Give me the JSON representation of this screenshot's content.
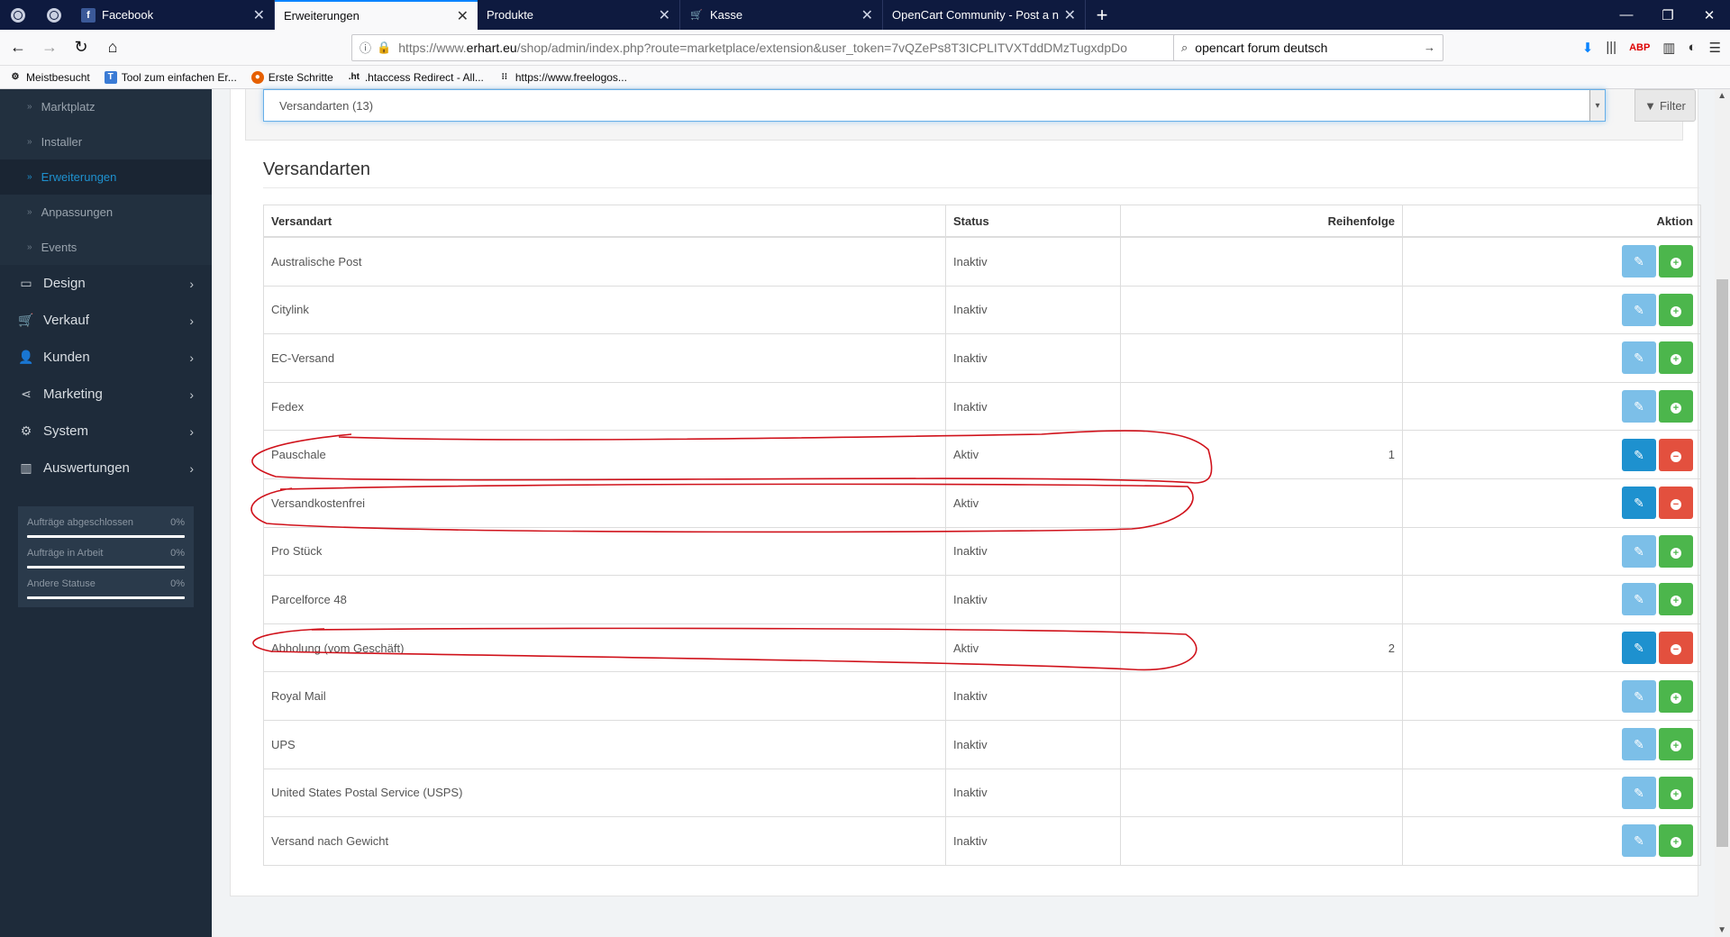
{
  "browser": {
    "tabs": [
      {
        "label": "Facebook",
        "icon": "facebook-icon"
      },
      {
        "label": "Erweiterungen",
        "icon": "",
        "active": true
      },
      {
        "label": "Produkte",
        "icon": ""
      },
      {
        "label": "Kasse",
        "icon": "cart-icon"
      },
      {
        "label": "OpenCart Community - Post a new",
        "icon": ""
      }
    ],
    "url_prefix": "https://www.",
    "url_domain": "erhart.eu",
    "url_path": "/shop/admin/index.php?route=marketplace/extension&user_token=7vQZePs8T3ICPLITVXTddDMzTugxdpDo",
    "search_value": "opencart forum deutsch",
    "bookmarks": [
      "Meistbesucht",
      "Tool zum einfachen Er...",
      "Erste Schritte",
      ".htaccess Redirect - All...",
      "https://www.freelogos..."
    ]
  },
  "sidebar": {
    "subitems": [
      {
        "label": "Marktplatz",
        "active": false
      },
      {
        "label": "Installer",
        "active": false
      },
      {
        "label": "Erweiterungen",
        "active": true
      },
      {
        "label": "Anpassungen",
        "active": false
      },
      {
        "label": "Events",
        "active": false
      }
    ],
    "menu": [
      {
        "label": "Design",
        "icon": "desktop-icon"
      },
      {
        "label": "Verkauf",
        "icon": "cart-icon"
      },
      {
        "label": "Kunden",
        "icon": "user-icon"
      },
      {
        "label": "Marketing",
        "icon": "share-icon"
      },
      {
        "label": "System",
        "icon": "gear-icon"
      },
      {
        "label": "Auswertungen",
        "icon": "bar-chart-icon"
      }
    ],
    "stats": [
      {
        "label": "Aufträge abgeschlossen",
        "value": "0%"
      },
      {
        "label": "Aufträge in Arbeit",
        "value": "0%"
      },
      {
        "label": "Andere Statuse",
        "value": "0%"
      }
    ]
  },
  "filter": {
    "selected": "Versandarten (13)",
    "button_label": "Filter"
  },
  "section": {
    "title": "Versandarten",
    "columns": [
      "Versandart",
      "Status",
      "Reihenfolge",
      "Aktion"
    ],
    "rows": [
      {
        "name": "Australische Post",
        "status": "Inaktiv",
        "order": "",
        "installed": false
      },
      {
        "name": "Citylink",
        "status": "Inaktiv",
        "order": "",
        "installed": false
      },
      {
        "name": "EC-Versand",
        "status": "Inaktiv",
        "order": "",
        "installed": false
      },
      {
        "name": "Fedex",
        "status": "Inaktiv",
        "order": "",
        "installed": false
      },
      {
        "name": "Pauschale",
        "status": "Aktiv",
        "order": "1",
        "installed": true
      },
      {
        "name": "Versandkostenfrei",
        "status": "Aktiv",
        "order": "",
        "installed": true
      },
      {
        "name": "Pro Stück",
        "status": "Inaktiv",
        "order": "",
        "installed": false
      },
      {
        "name": "Parcelforce 48",
        "status": "Inaktiv",
        "order": "",
        "installed": false
      },
      {
        "name": "Abholung (vom Geschäft)",
        "status": "Aktiv",
        "order": "2",
        "installed": true
      },
      {
        "name": "Royal Mail",
        "status": "Inaktiv",
        "order": "",
        "installed": false
      },
      {
        "name": "UPS",
        "status": "Inaktiv",
        "order": "",
        "installed": false
      },
      {
        "name": "United States Postal Service (USPS)",
        "status": "Inaktiv",
        "order": "",
        "installed": false
      },
      {
        "name": "Versand nach Gewicht",
        "status": "Inaktiv",
        "order": "",
        "installed": false
      }
    ]
  },
  "colors": {
    "annotation": "#d0121b",
    "primary": "#1e91cf",
    "success": "#4cb64c",
    "danger": "#e3503e"
  }
}
